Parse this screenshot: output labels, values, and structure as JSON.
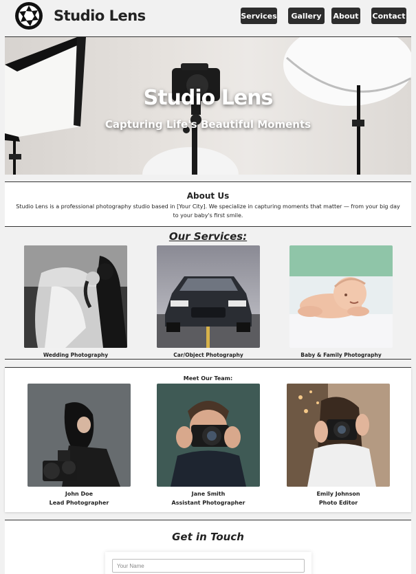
{
  "header": {
    "brand": "Studio Lens",
    "nav": [
      {
        "label": "Services"
      },
      {
        "label": "Gallery"
      },
      {
        "label": "About"
      },
      {
        "label": "Contact"
      }
    ]
  },
  "hero": {
    "title": "Studio Lens",
    "subtitle": "Capturing Life's Beautiful Moments"
  },
  "about": {
    "heading": "About Us",
    "text": "Studio Lens is a professional photography studio based in [Your City]. We specialize in capturing moments that matter — from your big day to your baby's first smile."
  },
  "services": {
    "heading": "Our Services:",
    "items": [
      {
        "label": "Wedding Photography"
      },
      {
        "label": "Car/Object Photography"
      },
      {
        "label": "Baby & Family Photography"
      }
    ]
  },
  "team": {
    "heading": "Meet Our Team:",
    "members": [
      {
        "name": "John Doe",
        "role": "Lead Photographer"
      },
      {
        "name": "Jane Smith",
        "role": "Assistant Photographer"
      },
      {
        "name": "Emily Johnson",
        "role": "Photo Editor"
      }
    ]
  },
  "contact": {
    "heading": "Get in Touch",
    "name_placeholder": "Your Name"
  }
}
